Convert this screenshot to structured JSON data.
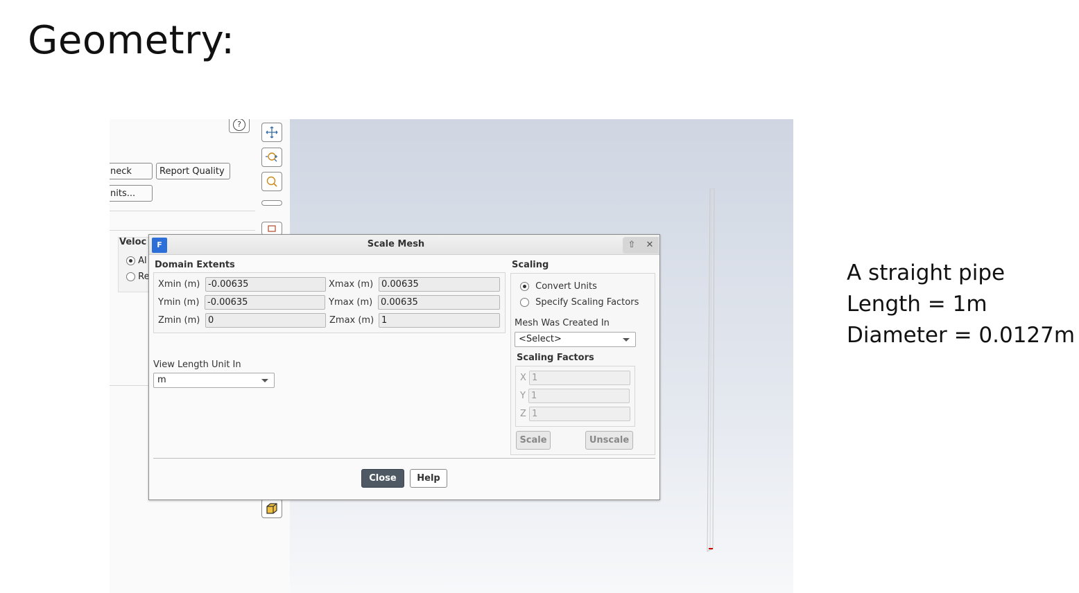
{
  "slide": {
    "title": "Geometry:",
    "caption": [
      "A straight pipe",
      "Length = 1m",
      "Diameter = 0.0127m"
    ]
  },
  "left_panel": {
    "buttons": [
      "neck",
      "Report Quality",
      "nits..."
    ],
    "velocity_label": "Veloc",
    "radio_options": [
      {
        "label": "Al",
        "selected": true
      },
      {
        "label": "Re",
        "selected": false
      }
    ]
  },
  "toolbar": {
    "icons": [
      "pan-icon",
      "zoom-out-icon",
      "zoom-fit-icon",
      "scroll-icon",
      "view-icon",
      "box-icon"
    ]
  },
  "dialog": {
    "logo": "F",
    "title": "Scale Mesh",
    "domain_extents": {
      "label": "Domain Extents",
      "xmin_label": "Xmin (m)",
      "xmin": "-0.00635",
      "xmax_label": "Xmax (m)",
      "xmax": "0.00635",
      "ymin_label": "Ymin (m)",
      "ymin": "-0.00635",
      "ymax_label": "Ymax (m)",
      "ymax": "0.00635",
      "zmin_label": "Zmin (m)",
      "zmin": "0",
      "zmax_label": "Zmax (m)",
      "zmax": "1"
    },
    "view_length": {
      "label": "View Length Unit In",
      "value": "m"
    },
    "scaling": {
      "label": "Scaling",
      "options": [
        {
          "label": "Convert Units",
          "selected": true
        },
        {
          "label": "Specify Scaling Factors",
          "selected": false
        }
      ],
      "mesh_created_label": "Mesh Was Created In",
      "mesh_created_value": "<Select>",
      "factors_label": "Scaling Factors",
      "x_label": "X",
      "x": "1",
      "y_label": "Y",
      "y": "1",
      "z_label": "Z",
      "z": "1",
      "scale_label": "Scale",
      "unscale_label": "Unscale"
    },
    "close_label": "Close",
    "help_label": "Help"
  },
  "colors": {
    "logo_blue": "#2d6fd8",
    "close_button": "#4f5964",
    "viewport_top": "#cfd6e2",
    "pipe_outlet": "#cc0000"
  }
}
